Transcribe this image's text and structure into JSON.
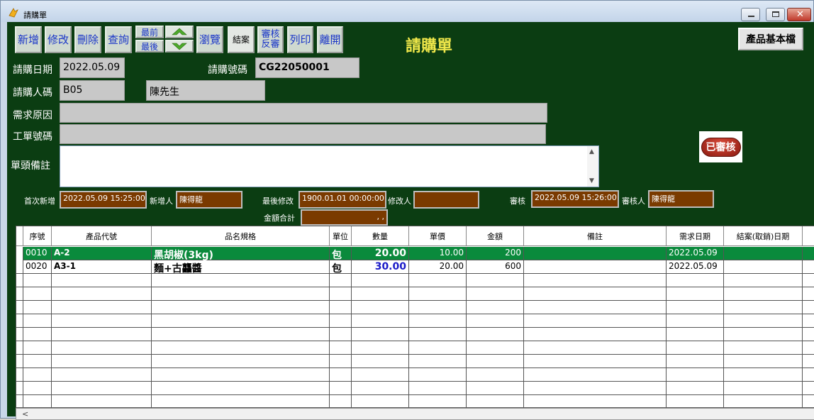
{
  "window": {
    "title": "請購單"
  },
  "toolbar": {
    "add": "新增",
    "edit": "修改",
    "delete": "刪除",
    "query": "查詢",
    "first": "最前",
    "last": "最後",
    "browse": "瀏覽",
    "close_case": "結案",
    "approve_revert_line1": "審核",
    "approve_revert_line2": "反審",
    "print": "列印",
    "exit": "離開"
  },
  "form_title": "請購單",
  "product_master_button": "產品基本檔",
  "header": {
    "request_date_label": "請購日期",
    "request_date": "2022.05.09",
    "request_no_label": "請購號碼",
    "request_no": "CG22050001",
    "requester_code_label": "請購人碼",
    "requester_code": "B05",
    "requester_name": "陳先生",
    "reason_label": "需求原因",
    "reason": "",
    "work_order_label": "工單號碼",
    "work_order": "",
    "remark_label": "單頭備註",
    "remark": ""
  },
  "status_badge": "已審核",
  "audit": {
    "first_added_label": "首次新增",
    "first_added": "2022.05.09 15:25:00",
    "added_by_label": "新增人",
    "added_by": "陳得龍",
    "last_modified_label": "最後修改",
    "last_modified": "1900.01.01 00:00:00",
    "modified_by_label": "修改人",
    "modified_by": "",
    "approved_label": "審核",
    "approved_at": "2022.05.09 15:26:00",
    "approver_label": "審核人",
    "approver": "陳得龍",
    "total_label": "金額合計",
    "total": ",   ,"
  },
  "grid": {
    "columns": [
      "序號",
      "產品代號",
      "品名規格",
      "單位",
      "數量",
      "單價",
      "金額",
      "備註",
      "需求日期",
      "結案(取銷)日期"
    ],
    "rows": [
      {
        "seq": "0010",
        "code": "A-2",
        "name": "黑胡椒(3kg)",
        "unit": "包",
        "qty": "20.00",
        "price": "10.00",
        "amount": "200",
        "note": "",
        "need_date": "2022.05.09",
        "close_date": ""
      },
      {
        "seq": "0020",
        "code": "A3-1",
        "name": "麵+古龘醬",
        "unit": "包",
        "qty": "30.00",
        "price": "20.00",
        "amount": "600",
        "note": "",
        "need_date": "2022.05.09",
        "close_date": ""
      }
    ]
  },
  "colors": {
    "background": "#0b3d12",
    "title_yellow": "#f0e84a",
    "selected_row": "#0a8a3c",
    "qty_blue": "#1a1ac8",
    "brown_field": "#7a3a00"
  }
}
